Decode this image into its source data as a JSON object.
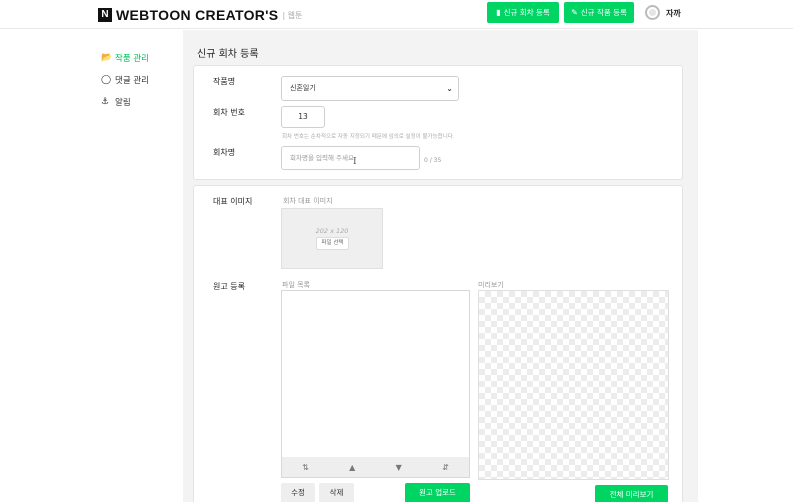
{
  "header": {
    "logo_mark": "N",
    "logo_text": "WEBTOON CREATOR'S",
    "logo_sub": "| 웹툰",
    "new_episode_button": "신규 회차 등록",
    "new_work_button": "신규 작품 등록",
    "user_name": "자까"
  },
  "sidebar": {
    "items": [
      {
        "label": "작품 관리",
        "icon": "folder-open-icon"
      },
      {
        "label": "댓글 관리",
        "icon": "speech-bubble-icon"
      },
      {
        "label": "알림",
        "icon": "bell-icon"
      }
    ]
  },
  "page": {
    "title": "신규 회차 등록"
  },
  "form": {
    "work_label": "작품명",
    "work_value": "신혼일기",
    "episode_no_label": "회차 번호",
    "episode_no_value": "13",
    "episode_no_help": "회차 번호는 순차적으로 자동 지정되기 때문에 임의로 설정이 불가능합니다.",
    "episode_title_label": "회차명",
    "episode_title_placeholder": "회차명을 입력해 주세요.",
    "episode_title_counter": "0 / 35"
  },
  "thumbnail": {
    "label": "대표 이미지",
    "sublabel": "회차 대표 이미지",
    "size_hint": "202 x 120",
    "select_button": "파일 선택"
  },
  "manuscript": {
    "label": "원고 등록",
    "file_list_label": "파일 목록",
    "preview_label": "미리보기",
    "tools": [
      "sort-ascending-icon",
      "move-up-icon",
      "move-down-icon",
      "sort-descending-icon"
    ],
    "edit_button": "수정",
    "delete_button": "삭제",
    "upload_button": "원고 업로드",
    "full_preview_button": "전체 미리보기"
  },
  "colors": {
    "accent": "#00d564",
    "background": "#f3f3f3"
  }
}
